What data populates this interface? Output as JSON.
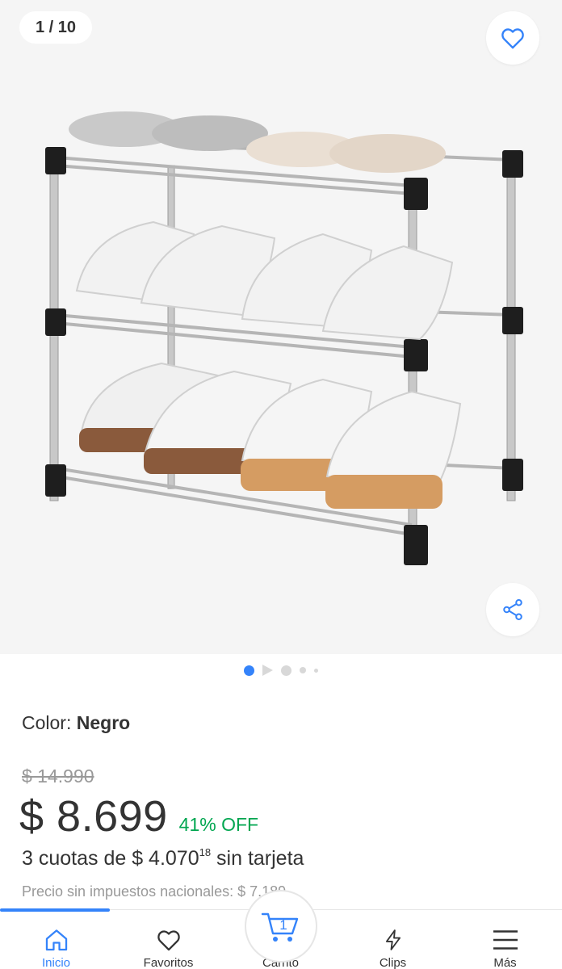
{
  "gallery": {
    "counter": "1 / 10",
    "slides_total": 10,
    "current_slide": 1
  },
  "product": {
    "color_label": "Color:",
    "color_value": "Negro",
    "original_price": "$ 14.990",
    "price": "$ 8.699",
    "discount": "41% OFF",
    "installments_prefix": "3 cuotas de $ 4.070",
    "installments_cents": "18",
    "installments_suffix": " sin tarjeta",
    "tax_note": "Precio sin impuestos nacionales: $ 7.189"
  },
  "nav": {
    "items": [
      {
        "label": "Inicio",
        "icon": "home-icon"
      },
      {
        "label": "Favoritos",
        "icon": "heart-icon"
      },
      {
        "label": "Carrito",
        "icon": "cart-icon"
      },
      {
        "label": "Clips",
        "icon": "lightning-icon"
      },
      {
        "label": "Más",
        "icon": "menu-icon"
      }
    ],
    "active": "Inicio",
    "cart_count": "1"
  },
  "colors": {
    "accent": "#3483fa",
    "discount": "#00a650",
    "muted": "#999999",
    "text": "#333333"
  }
}
